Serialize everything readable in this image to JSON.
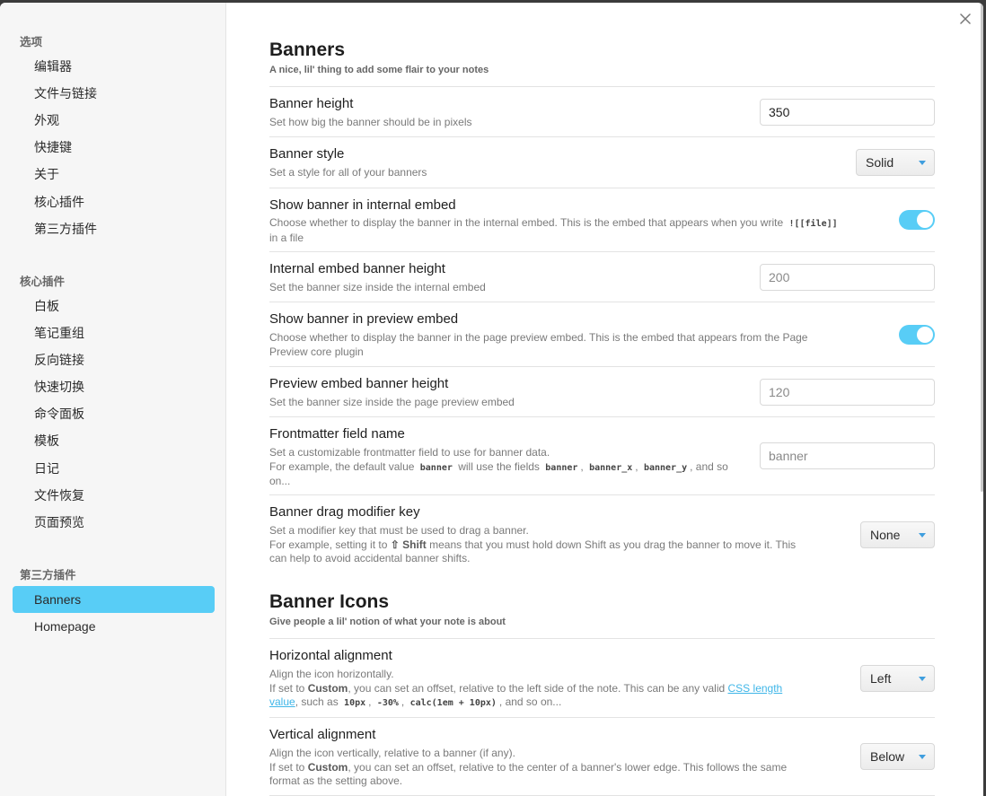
{
  "sidebar": {
    "group_options": "选项",
    "options_items": [
      "编辑器",
      "文件与链接",
      "外观",
      "快捷键",
      "关于",
      "核心插件",
      "第三方插件"
    ],
    "group_core": "核心插件",
    "core_items": [
      "白板",
      "笔记重组",
      "反向链接",
      "快速切换",
      "命令面板",
      "模板",
      "日记",
      "文件恢复",
      "页面预览"
    ],
    "group_community": "第三方插件",
    "community_items": [
      "Banners",
      "Homepage"
    ],
    "active_item": "Banners"
  },
  "close_icon": "close-icon",
  "banners": {
    "title": "Banners",
    "description": "A nice, lil' thing to add some flair to your notes",
    "height": {
      "name": "Banner height",
      "desc": "Set how big the banner should be in pixels",
      "value": "350"
    },
    "style": {
      "name": "Banner style",
      "desc": "Set a style for all of your banners",
      "value": "Solid"
    },
    "internal_embed": {
      "name": "Show banner in internal embed",
      "desc_1": "Choose whether to display the banner in the internal embed. This is the embed that appears when you write ",
      "desc_code": "![[file]]",
      "desc_2": "in a file",
      "enabled": true
    },
    "internal_height": {
      "name": "Internal embed banner height",
      "desc": "Set the banner size inside the internal embed",
      "placeholder": "200"
    },
    "preview_embed": {
      "name": "Show banner in preview embed",
      "desc_1": "Choose whether to display the banner in the page preview embed. This is the embed that appears from the Page",
      "desc_2": "Preview core plugin",
      "enabled": true
    },
    "preview_height": {
      "name": "Preview embed banner height",
      "desc": "Set the banner size inside the page preview embed",
      "placeholder": "120"
    },
    "frontmatter": {
      "name": "Frontmatter field name",
      "desc_1": "Set a customizable frontmatter field to use for banner data.",
      "desc_2a": "For example, the default value ",
      "code_banner": "banner",
      "desc_2b": " will use the fields ",
      "code_field1": "banner",
      "sep1": ",",
      "code_field2": "banner_x",
      "sep2": ",",
      "code_field3": "banner_y",
      "desc_2c": ", and so",
      "desc_3": "on...",
      "placeholder": "banner"
    },
    "drag_key": {
      "name": "Banner drag modifier key",
      "desc_1": "Set a modifier key that must be used to drag a banner.",
      "desc_2a": "For example, setting it to ",
      "desc_2_key": "⇧ Shift",
      "desc_2b": " means that you must hold down Shift as you drag the banner to move it. This",
      "desc_3": "can help to avoid accidental banner shifts.",
      "value": "None"
    }
  },
  "icons": {
    "title": "Banner Icons",
    "description": "Give people a lil' notion of what your note is about",
    "horizontal": {
      "name": "Horizontal alignment",
      "desc_1": "Align the icon horizontally.",
      "desc_2a": "If set to ",
      "desc_2_strong": "Custom",
      "desc_2b": ", you can set an offset, relative to the left side of the note. This can be any valid ",
      "link_a": "CSS length",
      "link_b": "value",
      "desc_3a": ", such as ",
      "code1": "10px",
      "code2": "-30%",
      "code3": "calc(1em + 10px)",
      "desc_3b": ", and so on...",
      "value": "Left"
    },
    "vertical": {
      "name": "Vertical alignment",
      "desc_1": "Align the icon vertically, relative to a banner (if any).",
      "desc_2a": "If set to ",
      "desc_2_strong": "Custom",
      "desc_2b": ", you can set an offset, relative to the center of a banner's lower edge. This follows the same",
      "desc_3": "format as the setting above.",
      "value": "Below"
    }
  }
}
